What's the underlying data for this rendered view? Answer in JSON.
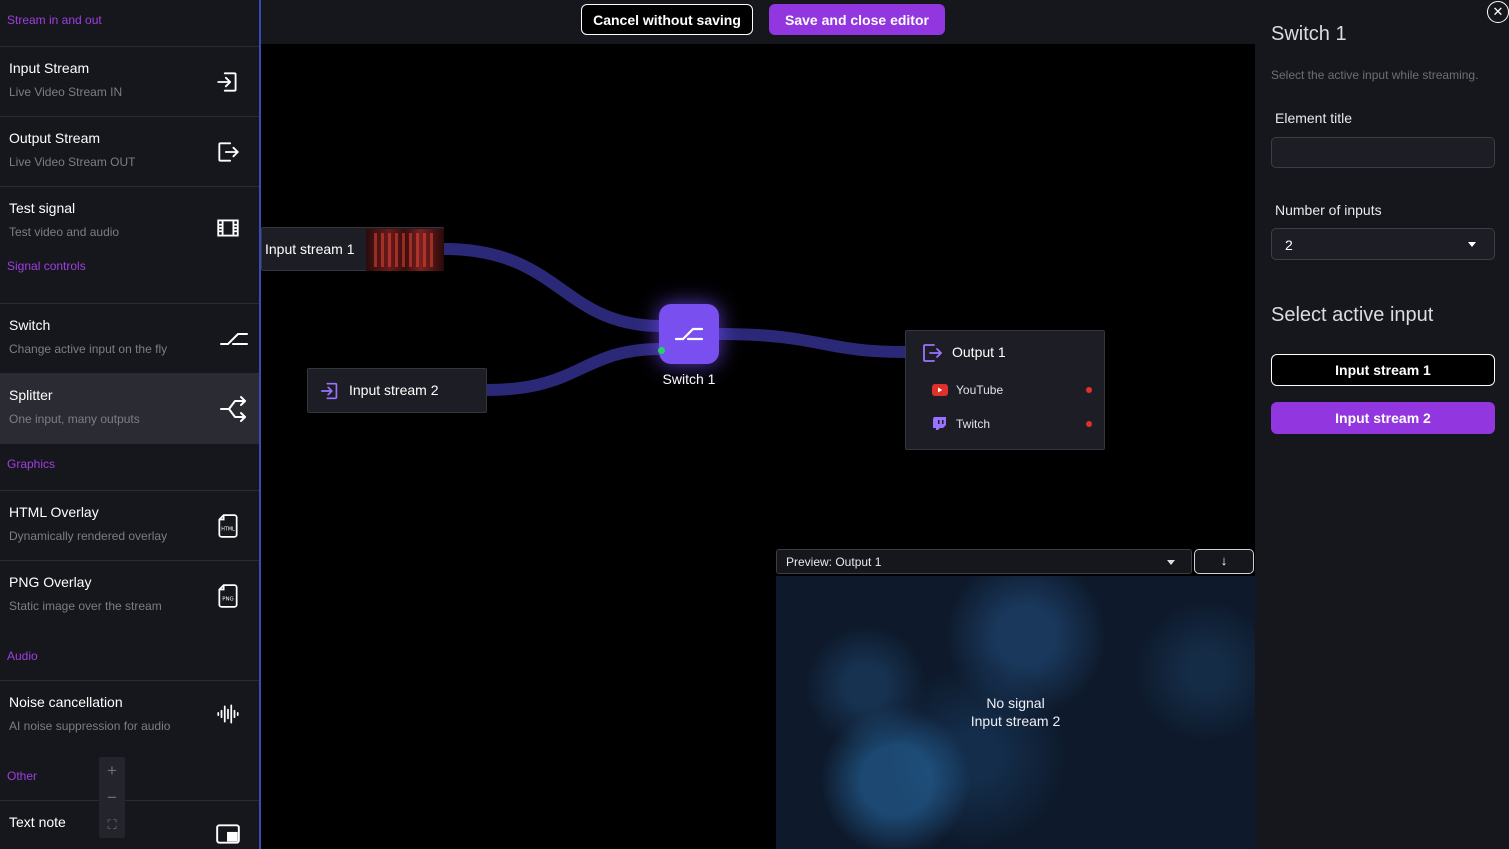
{
  "sidebar": {
    "sections": [
      {
        "label": "Stream in and out",
        "items": [
          {
            "title": "Input Stream",
            "subtitle": "Live Video Stream IN",
            "icon": "login-icon"
          },
          {
            "title": "Output Stream",
            "subtitle": "Live Video Stream OUT",
            "icon": "logout-icon"
          },
          {
            "title": "Test signal",
            "subtitle": "Test video and audio",
            "icon": "film-icon"
          }
        ]
      },
      {
        "label": "Signal controls",
        "items": [
          {
            "title": "Switch",
            "subtitle": "Change active input on the fly",
            "icon": "switch-icon"
          },
          {
            "title": "Splitter",
            "subtitle": "One input, many outputs",
            "icon": "splitter-icon"
          }
        ]
      },
      {
        "label": "Graphics",
        "items": [
          {
            "title": "HTML Overlay",
            "subtitle": "Dynamically rendered overlay",
            "icon": "html-file-icon"
          },
          {
            "title": "PNG Overlay",
            "subtitle": "Static image over the stream",
            "icon": "png-file-icon"
          }
        ]
      },
      {
        "label": "Audio",
        "items": [
          {
            "title": "Noise cancellation",
            "subtitle": "AI noise suppression for audio",
            "icon": "waveform-icon"
          }
        ]
      },
      {
        "label": "Other",
        "items": [
          {
            "title": "Text note",
            "subtitle": "",
            "icon": "note-icon"
          }
        ]
      }
    ],
    "active_item": "Splitter"
  },
  "toolbar": {
    "cancel_label": "Cancel without saving",
    "save_label": "Save and close editor"
  },
  "zoom": {
    "in": "+",
    "out": "−",
    "fit": "⛶"
  },
  "nodes": {
    "input1": {
      "label": "Input stream 1"
    },
    "input2": {
      "label": "Input stream 2"
    },
    "switch": {
      "label": "Switch 1"
    },
    "output": {
      "label": "Output 1",
      "destinations": [
        {
          "name": "YouTube",
          "icon": "youtube-icon",
          "status_color": "#e0302a"
        },
        {
          "name": "Twitch",
          "icon": "twitch-icon",
          "status_color": "#e0302a"
        }
      ]
    }
  },
  "preview": {
    "selected": "Preview: Output 1",
    "download_icon": "↓",
    "message_line1": "No signal",
    "message_line2": "Input stream 2"
  },
  "panel": {
    "title": "Switch 1",
    "subtitle": "Select the active input while streaming.",
    "element_title_label": "Element title",
    "element_title_value": "",
    "num_inputs_label": "Number of inputs",
    "num_inputs_value": "2",
    "select_active_label": "Select active input",
    "inputs": [
      {
        "label": "Input stream 1",
        "active": false
      },
      {
        "label": "Input stream 2",
        "active": true
      }
    ]
  },
  "colors": {
    "accent": "#9236e0",
    "switch_node": "#7a4ff0",
    "wire": "#2e2a7e",
    "status_dot": "#e0302a",
    "connected_dot": "#22d36a"
  }
}
